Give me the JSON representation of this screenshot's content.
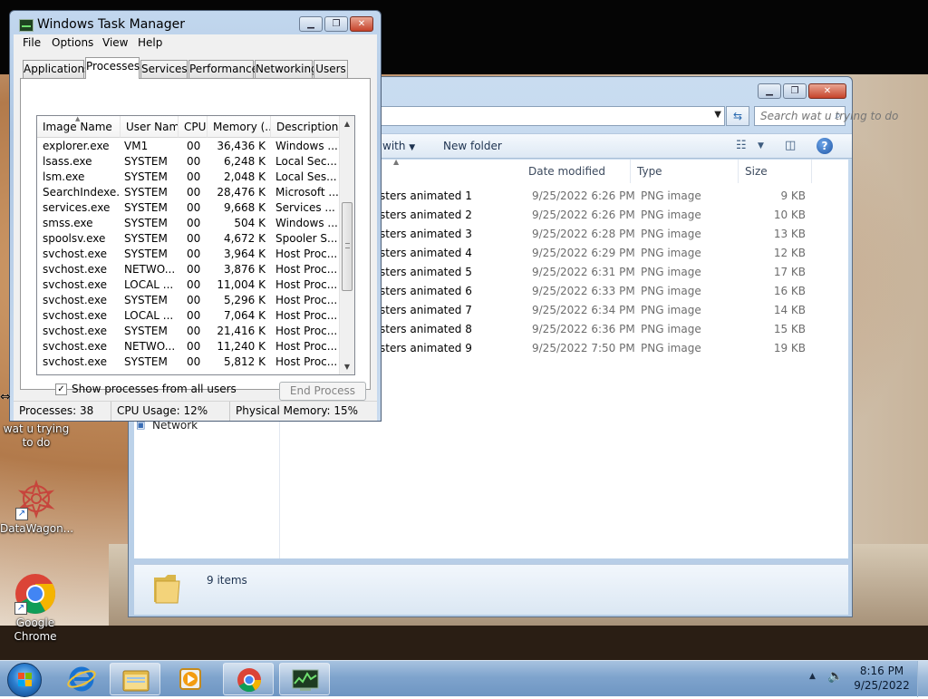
{
  "desktop": {
    "icons": [
      {
        "label": "wat u trying to do",
        "icon": "folder-shortcut-icon"
      },
      {
        "label": "DataWagon...",
        "icon": "datawagon-logo-icon"
      },
      {
        "label": "Google Chrome",
        "icon": "chrome-icon"
      }
    ]
  },
  "explorer": {
    "search_placeholder": "Search wat u trying to do",
    "toolbar": {
      "open_with": "with",
      "new_folder": "New folder"
    },
    "columns": {
      "date": "Date modified",
      "type": "Type",
      "size": "Size"
    },
    "files": [
      {
        "name": "sters animated 1",
        "date": "9/25/2022 6:26 PM",
        "type": "PNG image",
        "size": "9 KB"
      },
      {
        "name": "sters animated 2",
        "date": "9/25/2022 6:26 PM",
        "type": "PNG image",
        "size": "10 KB"
      },
      {
        "name": "sters animated 3",
        "date": "9/25/2022 6:28 PM",
        "type": "PNG image",
        "size": "13 KB"
      },
      {
        "name": "sters animated 4",
        "date": "9/25/2022 6:29 PM",
        "type": "PNG image",
        "size": "12 KB"
      },
      {
        "name": "sters animated 5",
        "date": "9/25/2022 6:31 PM",
        "type": "PNG image",
        "size": "17 KB"
      },
      {
        "name": "sters animated 6",
        "date": "9/25/2022 6:33 PM",
        "type": "PNG image",
        "size": "16 KB"
      },
      {
        "name": "sters animated 7",
        "date": "9/25/2022 6:34 PM",
        "type": "PNG image",
        "size": "14 KB"
      },
      {
        "name": "sters animated 8",
        "date": "9/25/2022 6:36 PM",
        "type": "PNG image",
        "size": "15 KB"
      },
      {
        "name": "sters animated 9",
        "date": "9/25/2022 7:50 PM",
        "type": "PNG image",
        "size": "19 KB"
      }
    ],
    "nav": {
      "network": "Network"
    },
    "details": {
      "items_count": "9 items"
    }
  },
  "taskmgr": {
    "title": "Windows Task Manager",
    "menu": [
      "File",
      "Options",
      "View",
      "Help"
    ],
    "tabs": [
      "Applications",
      "Processes",
      "Services",
      "Performance",
      "Networking",
      "Users"
    ],
    "active_tab": "Processes",
    "columns": [
      "Image Name",
      "User Name",
      "CPU",
      "Memory (...",
      "Description"
    ],
    "processes": [
      {
        "image": "explorer.exe",
        "user": "VM1",
        "cpu": "00",
        "mem": "36,436 K",
        "desc": "Windows ..."
      },
      {
        "image": "lsass.exe",
        "user": "SYSTEM",
        "cpu": "00",
        "mem": "6,248 K",
        "desc": "Local Sec..."
      },
      {
        "image": "lsm.exe",
        "user": "SYSTEM",
        "cpu": "00",
        "mem": "2,048 K",
        "desc": "Local Ses..."
      },
      {
        "image": "SearchIndexe...",
        "user": "SYSTEM",
        "cpu": "00",
        "mem": "28,476 K",
        "desc": "Microsoft ..."
      },
      {
        "image": "services.exe",
        "user": "SYSTEM",
        "cpu": "00",
        "mem": "9,668 K",
        "desc": "Services ..."
      },
      {
        "image": "smss.exe",
        "user": "SYSTEM",
        "cpu": "00",
        "mem": "504 K",
        "desc": "Windows ..."
      },
      {
        "image": "spoolsv.exe",
        "user": "SYSTEM",
        "cpu": "00",
        "mem": "4,672 K",
        "desc": "Spooler S..."
      },
      {
        "image": "svchost.exe",
        "user": "SYSTEM",
        "cpu": "00",
        "mem": "3,964 K",
        "desc": "Host Proc..."
      },
      {
        "image": "svchost.exe",
        "user": "NETWO...",
        "cpu": "00",
        "mem": "3,876 K",
        "desc": "Host Proc..."
      },
      {
        "image": "svchost.exe",
        "user": "LOCAL ...",
        "cpu": "00",
        "mem": "11,004 K",
        "desc": "Host Proc..."
      },
      {
        "image": "svchost.exe",
        "user": "SYSTEM",
        "cpu": "00",
        "mem": "5,296 K",
        "desc": "Host Proc..."
      },
      {
        "image": "svchost.exe",
        "user": "LOCAL ...",
        "cpu": "00",
        "mem": "7,064 K",
        "desc": "Host Proc..."
      },
      {
        "image": "svchost.exe",
        "user": "SYSTEM",
        "cpu": "00",
        "mem": "21,416 K",
        "desc": "Host Proc..."
      },
      {
        "image": "svchost.exe",
        "user": "NETWO...",
        "cpu": "00",
        "mem": "11,240 K",
        "desc": "Host Proc..."
      },
      {
        "image": "svchost.exe",
        "user": "SYSTEM",
        "cpu": "00",
        "mem": "5,812 K",
        "desc": "Host Proc..."
      }
    ],
    "show_all_label": "Show processes from all users",
    "show_all_checked": true,
    "end_process_label": "End Process",
    "status": {
      "processes": "Processes: 38",
      "cpu": "CPU Usage: 12%",
      "memory": "Physical Memory: 15%"
    }
  },
  "taskbar": {
    "pinned": [
      "internet-explorer-icon",
      "windows-explorer-icon",
      "media-player-icon",
      "chrome-icon",
      "task-manager-icon"
    ],
    "clock_time": "8:16 PM",
    "clock_date": "9/25/2022"
  },
  "colors": {
    "accent": "#2d7fd0",
    "taskbar": "#7fa4cd",
    "close_red": "#c6432b"
  }
}
